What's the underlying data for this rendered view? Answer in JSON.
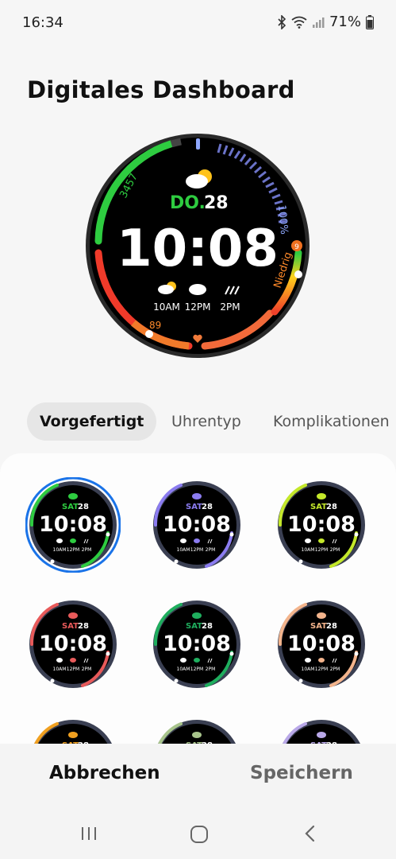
{
  "status": {
    "time": "16:34",
    "battery": "71%"
  },
  "title": "Digitales Dashboard",
  "hero": {
    "day": "DO.",
    "date": "28",
    "time": "10:08",
    "steps": "3457",
    "battery": "100%",
    "uv_label": "Niedrig",
    "uv_value": "9",
    "heart": "89",
    "forecast": [
      {
        "time": "10AM",
        "icon": "partly-cloudy-icon"
      },
      {
        "time": "12PM",
        "icon": "cloud-icon"
      },
      {
        "time": "2PM",
        "icon": "rain-icon"
      }
    ]
  },
  "tabs": [
    {
      "label": "Vorgefertigt",
      "active": true
    },
    {
      "label": "Uhrentyp",
      "active": false
    },
    {
      "label": "Komplikationen",
      "active": false
    }
  ],
  "thumbnails": {
    "day": "SAT",
    "date": "28",
    "time": "10:08",
    "forecast": [
      "10AM",
      "12PM",
      "2PM"
    ],
    "items": [
      {
        "color": "#2ecc40",
        "selected": true
      },
      {
        "color": "#8b7cf0",
        "selected": false
      },
      {
        "color": "#c4e82a",
        "selected": false
      },
      {
        "color": "#e85a5a",
        "selected": false
      },
      {
        "color": "#1fae5e",
        "selected": false
      },
      {
        "color": "#f3b48c",
        "selected": false
      },
      {
        "color": "#f0a020",
        "selected": false
      },
      {
        "color": "#a8c48c",
        "selected": false
      },
      {
        "color": "#b9a8e8",
        "selected": false
      }
    ]
  },
  "footer": {
    "cancel": "Abbrechen",
    "save": "Speichern"
  }
}
